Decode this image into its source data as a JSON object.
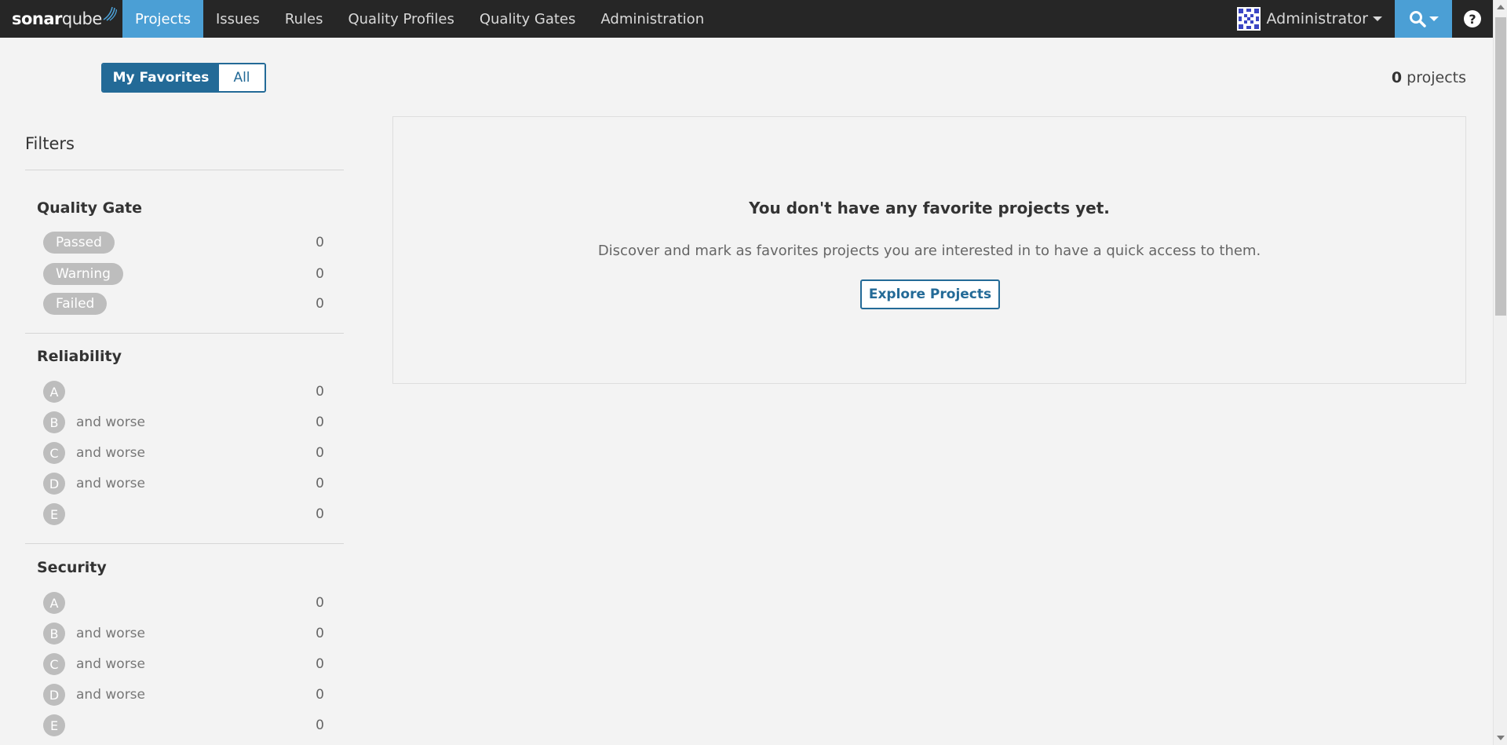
{
  "nav": {
    "logo_prefix": "sonar",
    "logo_suffix": "qube",
    "items": [
      "Projects",
      "Issues",
      "Rules",
      "Quality Profiles",
      "Quality Gates",
      "Administration"
    ],
    "user": "Administrator",
    "search_icon": "search-icon",
    "help_label": "?"
  },
  "toggle": {
    "favorites": "My Favorites",
    "all": "All"
  },
  "projects_count": {
    "value": "0",
    "label": "projects"
  },
  "filters": {
    "title": "Filters",
    "quality_gate": {
      "title": "Quality Gate",
      "rows": [
        {
          "label": "Passed",
          "count": "0"
        },
        {
          "label": "Warning",
          "count": "0"
        },
        {
          "label": "Failed",
          "count": "0"
        }
      ]
    },
    "reliability": {
      "title": "Reliability",
      "rows": [
        {
          "grade": "A",
          "suffix": "",
          "count": "0"
        },
        {
          "grade": "B",
          "suffix": "and worse",
          "count": "0"
        },
        {
          "grade": "C",
          "suffix": "and worse",
          "count": "0"
        },
        {
          "grade": "D",
          "suffix": "and worse",
          "count": "0"
        },
        {
          "grade": "E",
          "suffix": "",
          "count": "0"
        }
      ]
    },
    "security": {
      "title": "Security",
      "rows": [
        {
          "grade": "A",
          "suffix": "",
          "count": "0"
        },
        {
          "grade": "B",
          "suffix": "and worse",
          "count": "0"
        },
        {
          "grade": "C",
          "suffix": "and worse",
          "count": "0"
        },
        {
          "grade": "D",
          "suffix": "and worse",
          "count": "0"
        },
        {
          "grade": "E",
          "suffix": "",
          "count": "0"
        }
      ]
    }
  },
  "empty_state": {
    "title": "You don't have any favorite projects yet.",
    "text": "Discover and mark as favorites projects you are interested in to have a quick access to them.",
    "button": "Explore Projects"
  },
  "colors": {
    "nav_bg": "#262626",
    "accent": "#4b9fd5",
    "primary": "#236a97"
  }
}
